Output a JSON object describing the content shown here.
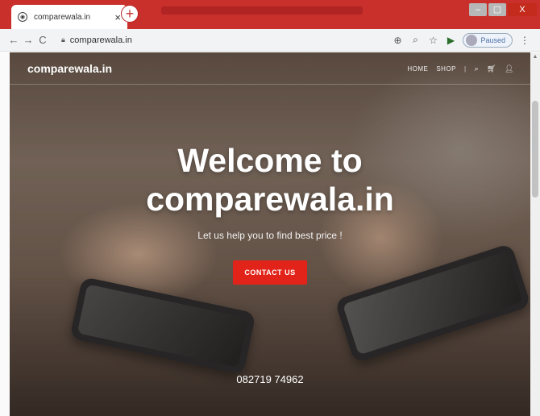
{
  "browser": {
    "tab_title": "comparewala.in",
    "tab_close": "×",
    "new_tab": "+",
    "url": "comparewala.in",
    "profile_status": "Paused",
    "window_controls": {
      "minimize": "–",
      "maximize": "▢",
      "close": "X"
    }
  },
  "site": {
    "logo": "comparewala.in",
    "nav": {
      "home": "HOME",
      "shop": "SHOP"
    },
    "hero": {
      "title_line1": "Welcome to",
      "title_line2": "comparewala.in",
      "subtitle": "Let us help you to find best price !",
      "cta": "CONTACT US"
    },
    "phone": "082719 74962"
  },
  "colors": {
    "accent": "#e2231a",
    "tabbar": "#c9302c"
  },
  "icons": [
    "globe-icon",
    "back-icon",
    "forward-icon",
    "reload-icon",
    "lock-icon",
    "location-icon",
    "zoom-icon",
    "star-icon",
    "extension-icon",
    "menu-icon",
    "search-icon",
    "cart-icon",
    "user-icon"
  ]
}
